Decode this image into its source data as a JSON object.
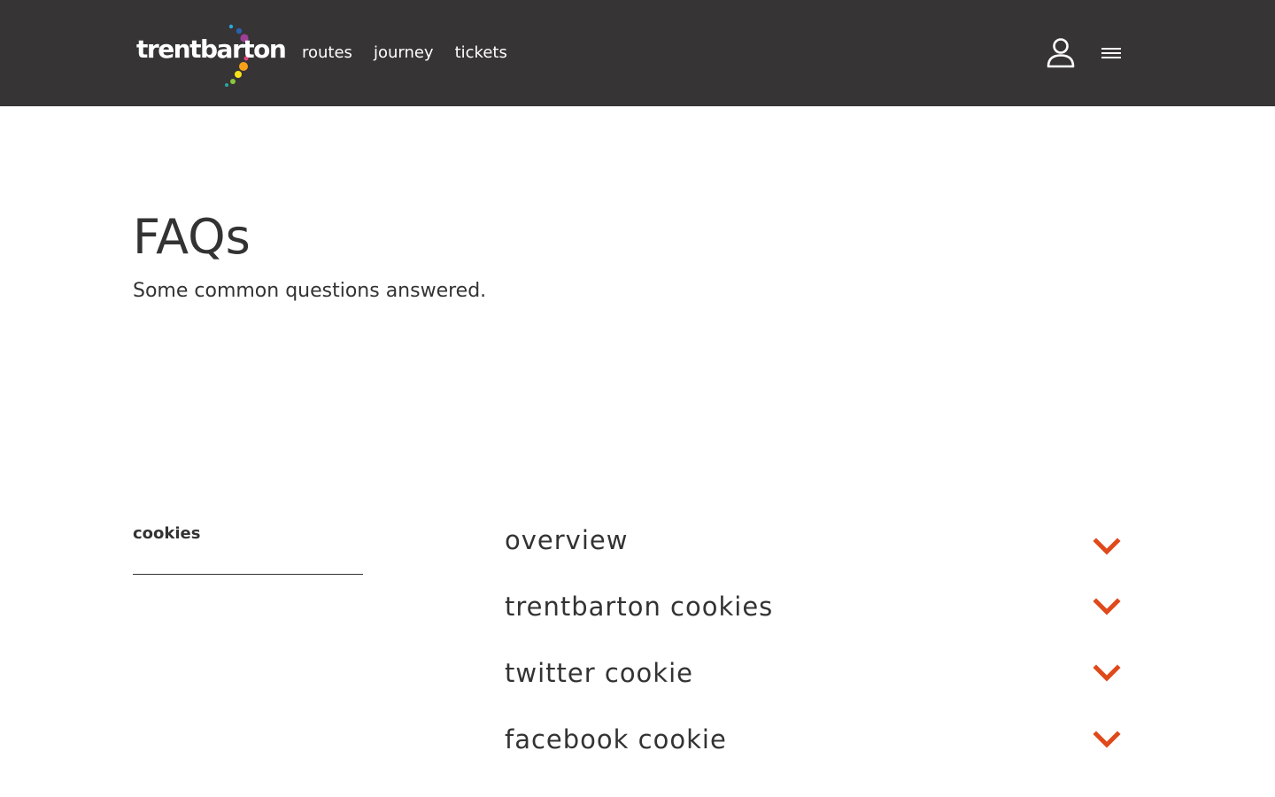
{
  "header": {
    "logo_text": "trentbarton",
    "nav": [
      {
        "label": "routes"
      },
      {
        "label": "journey"
      },
      {
        "label": "tickets"
      }
    ],
    "icons": {
      "account": "user-account-icon",
      "menu": "hamburger-menu-icon"
    }
  },
  "page": {
    "title": "FAQs",
    "subtitle": "Some common questions answered."
  },
  "sidebar": {
    "category": "cookies"
  },
  "faqs": [
    {
      "title": "overview",
      "icon": "chevron-down-icon"
    },
    {
      "title": "trentbarton cookies",
      "icon": "chevron-down-icon"
    },
    {
      "title": "twitter cookie",
      "icon": "chevron-down-icon"
    },
    {
      "title": "facebook cookie",
      "icon": "chevron-down-icon"
    }
  ],
  "colors": {
    "header_bg": "#363435",
    "text": "#333333",
    "accent": "#e0491a"
  }
}
